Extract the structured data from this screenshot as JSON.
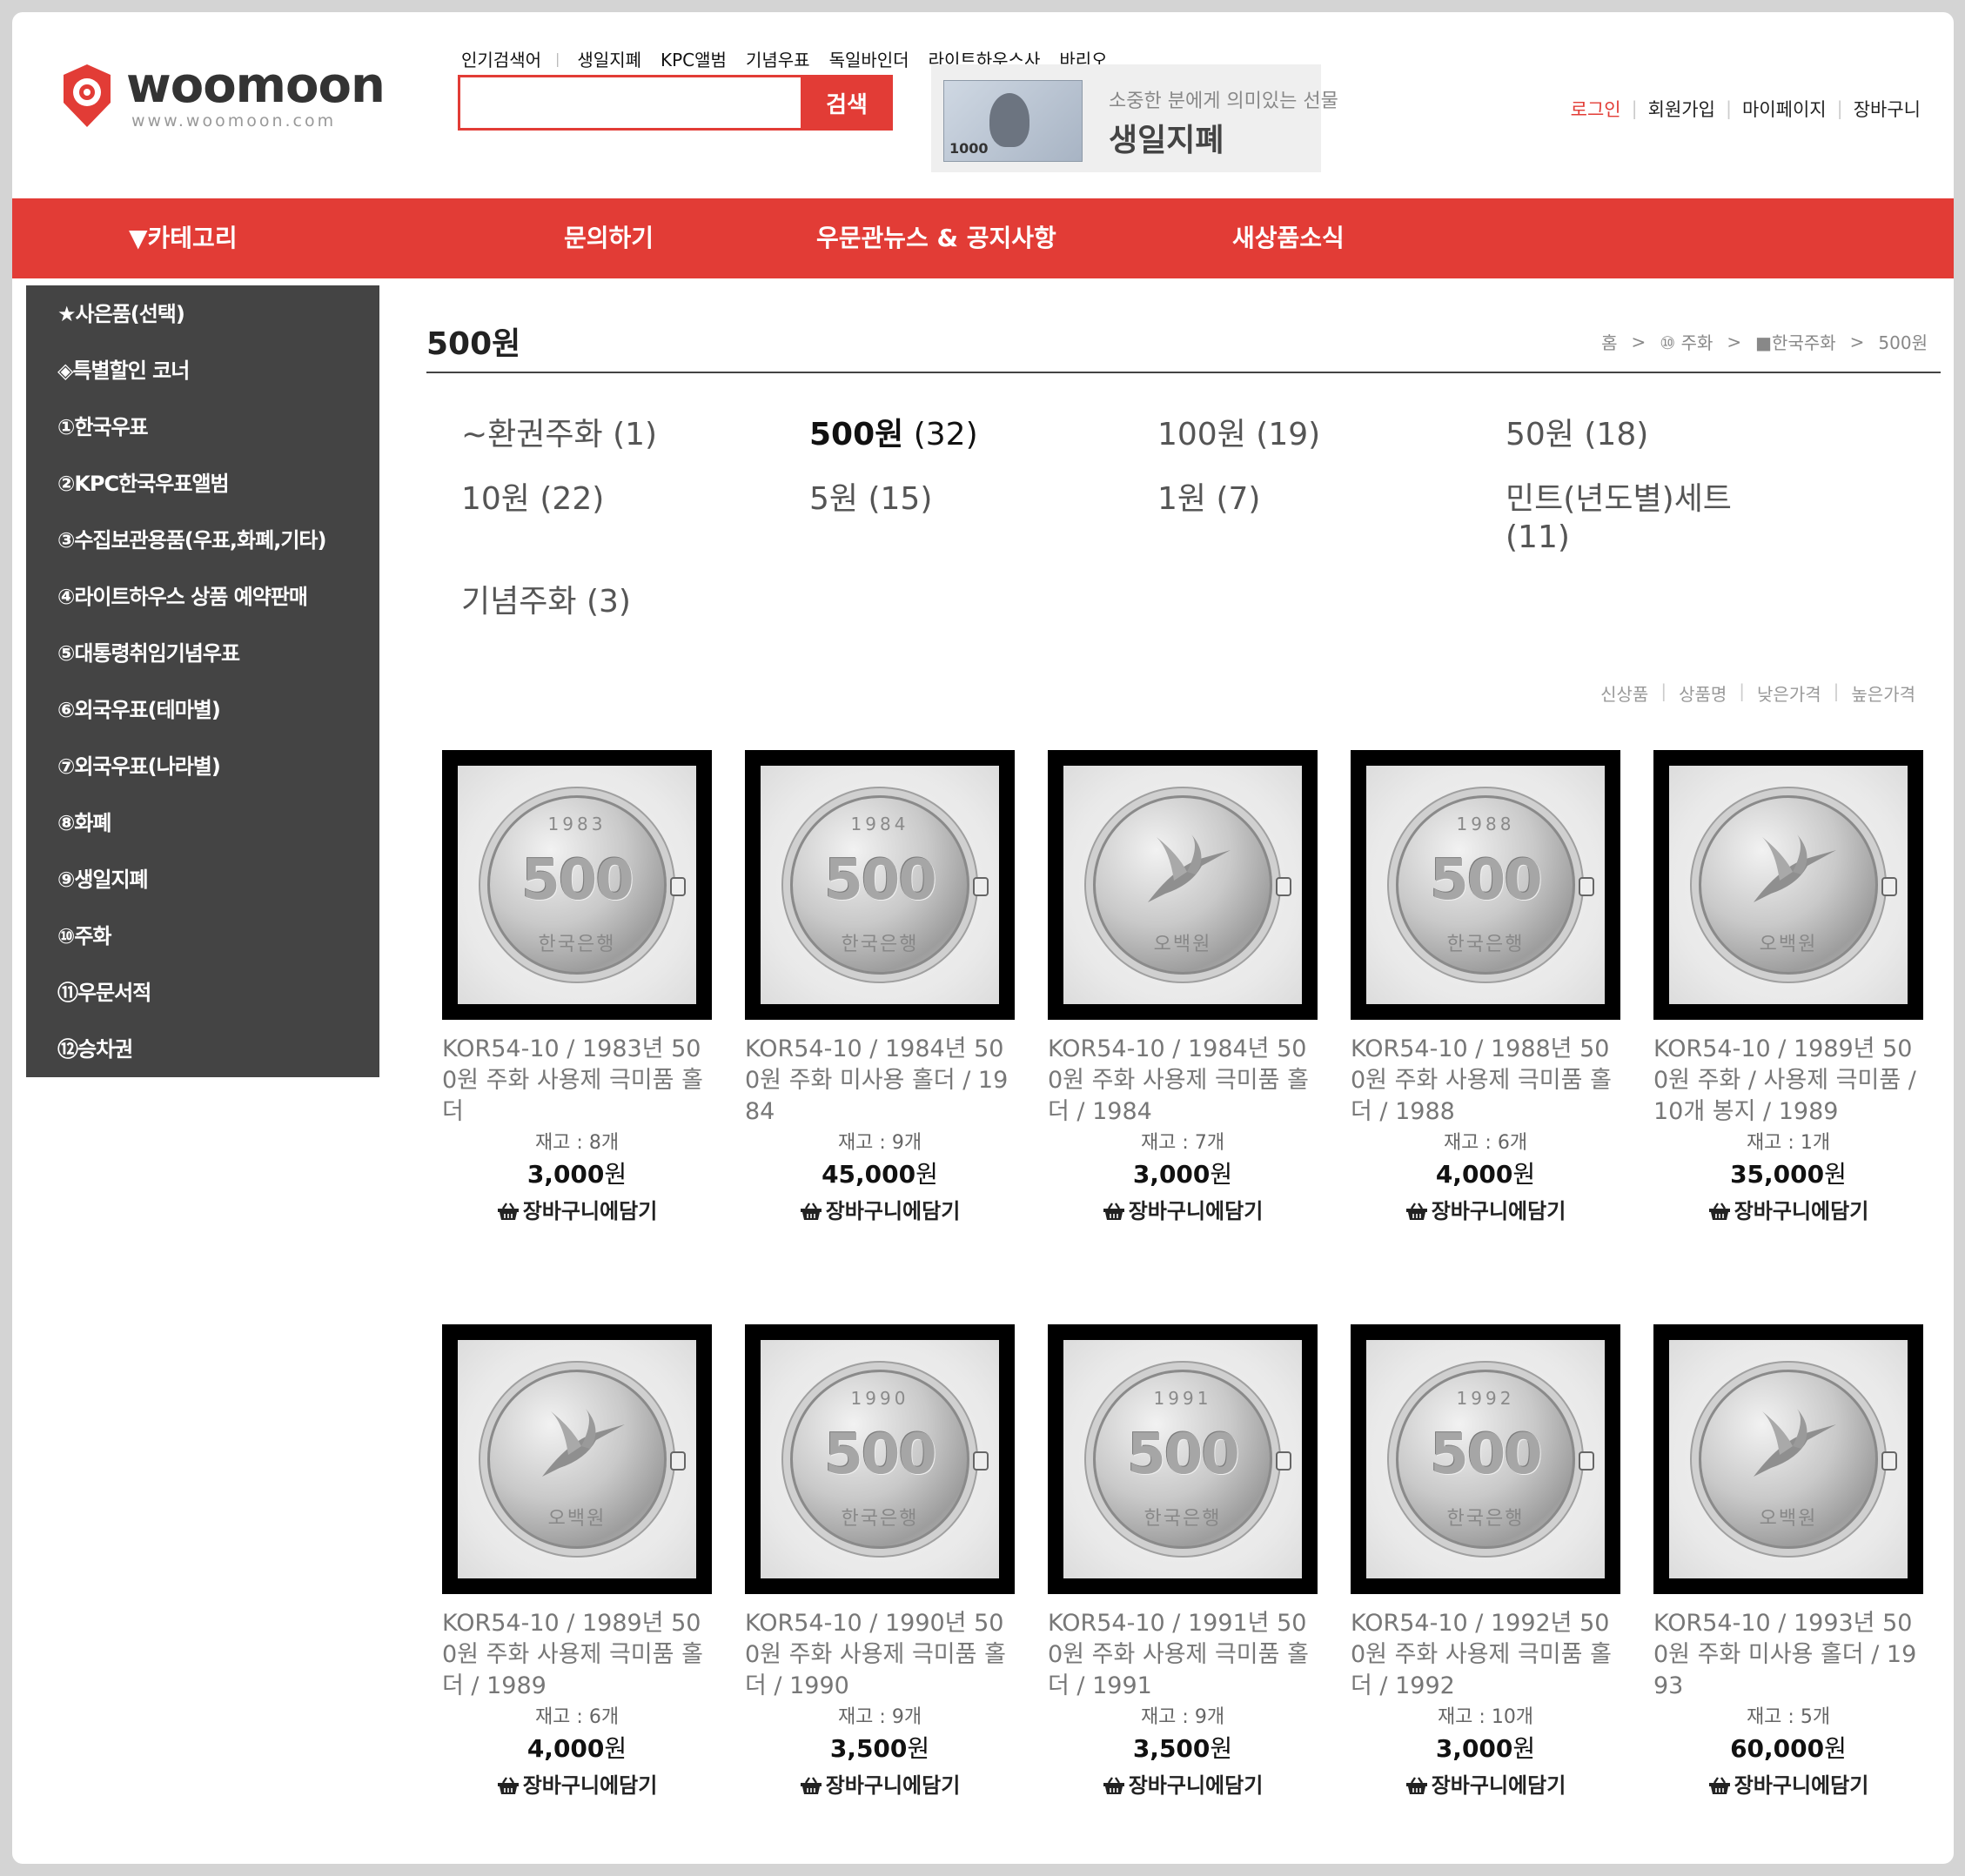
{
  "logo": {
    "name": "woomoon",
    "url": "www.woomoon.com"
  },
  "popular": {
    "label": "인기검색어",
    "keywords": [
      "생일지폐",
      "KPC앨범",
      "기념우표",
      "독일바인더",
      "라이트하우스사",
      "바리오"
    ]
  },
  "search": {
    "placeholder": "",
    "button_label": "검색"
  },
  "banner": {
    "note_value": "1000",
    "subtitle": "소중한 분에게 의미있는 선물",
    "title": "생일지폐"
  },
  "user_menu": {
    "login": "로그인",
    "join": "회원가입",
    "mypage": "마이페이지",
    "cart": "장바구니",
    "login_color": "#e23c36"
  },
  "nav": {
    "category": "▼카테고리",
    "inquiry": "문의하기",
    "news": "우문관뉴스 & 공지사항",
    "new_products": "새상품소식",
    "bar_color": "#e23c36"
  },
  "sidebar": {
    "items": [
      "★사은품(선택)",
      "◈특별할인 코너",
      "①한국우표",
      "②KPC한국우표앨범",
      "③수집보관용품(우표,화폐,기타)",
      "④라이트하우스 상품 예약판매",
      "⑤대통령취임기념우표",
      "⑥외국우표(테마별)",
      "⑦외국우표(나라별)",
      "⑧화폐",
      "⑨생일지폐",
      "⑩주화",
      "⑪우문서적",
      "⑫승차권"
    ]
  },
  "page": {
    "title": "500원"
  },
  "breadcrumb": [
    "홈",
    "⑩ 주화",
    "■한국주화",
    "500원"
  ],
  "categories": [
    {
      "name": "~환권주화",
      "count": "(1)"
    },
    {
      "name": "500원",
      "count": "(32)",
      "active": true
    },
    {
      "name": "100원",
      "count": "(19)"
    },
    {
      "name": "50원",
      "count": "(18)"
    },
    {
      "name": "10원",
      "count": "(22)"
    },
    {
      "name": "5원",
      "count": "(15)"
    },
    {
      "name": "1원",
      "count": "(7)"
    },
    {
      "name": "민트(년도별)세트",
      "count": "(11)"
    },
    {
      "name": "기념주화",
      "count": "(3)"
    }
  ],
  "sort": [
    "신상품",
    "상품명",
    "낮은가격",
    "높은가격"
  ],
  "cart_label": "장바구니에담기",
  "products": [
    {
      "name": "KOR54-10 / 1983년 500원 주화 사용제 극미품 홀더",
      "stock": "재고 : 8개",
      "price": "3,000",
      "unit": "원",
      "coin_year": "1983",
      "design": "number"
    },
    {
      "name": "KOR54-10 / 1984년 500원 주화 미사용 홀더 / 1984",
      "stock": "재고 : 9개",
      "price": "45,000",
      "unit": "원",
      "coin_year": "1984",
      "design": "number"
    },
    {
      "name": "KOR54-10 / 1984년 500원 주화 사용제 극미품 홀더 / 1984",
      "stock": "재고 : 7개",
      "price": "3,000",
      "unit": "원",
      "coin_year": "",
      "design": "crane"
    },
    {
      "name": "KOR54-10 / 1988년 500원 주화 사용제 극미품 홀더 / 1988",
      "stock": "재고 : 6개",
      "price": "4,000",
      "unit": "원",
      "coin_year": "1988",
      "design": "number"
    },
    {
      "name": "KOR54-10 / 1989년 500원 주화 / 사용제 극미품 / 10개 봉지 / 1989",
      "stock": "재고 : 1개",
      "price": "35,000",
      "unit": "원",
      "coin_year": "",
      "design": "crane"
    },
    {
      "name": "KOR54-10 / 1989년 500원 주화 사용제 극미품 홀더 / 1989",
      "stock": "재고 : 6개",
      "price": "4,000",
      "unit": "원",
      "coin_year": "",
      "design": "crane"
    },
    {
      "name": "KOR54-10 / 1990년 500원 주화 사용제 극미품 홀더 / 1990",
      "stock": "재고 : 9개",
      "price": "3,500",
      "unit": "원",
      "coin_year": "1990",
      "design": "number"
    },
    {
      "name": "KOR54-10 / 1991년 500원 주화 사용제 극미품 홀더 / 1991",
      "stock": "재고 : 9개",
      "price": "3,500",
      "unit": "원",
      "coin_year": "1991",
      "design": "number"
    },
    {
      "name": "KOR54-10 / 1992년 500원 주화 사용제 극미품 홀더 / 1992",
      "stock": "재고 : 10개",
      "price": "3,000",
      "unit": "원",
      "coin_year": "1992",
      "design": "number"
    },
    {
      "name": "KOR54-10 / 1993년 500원 주화 미사용 홀더 / 1993",
      "stock": "재고 : 5개",
      "price": "60,000",
      "unit": "원",
      "coin_year": "",
      "design": "crane"
    }
  ],
  "coin_text": {
    "number": "500",
    "bottom_number": "한국은행",
    "bottom_crane": "오백원"
  }
}
